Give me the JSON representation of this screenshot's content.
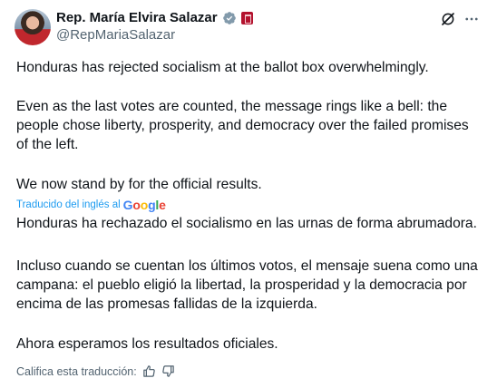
{
  "author": {
    "name": "Rep. María Elvira Salazar",
    "handle": "@RepMariaSalazar"
  },
  "icons": {
    "verified": "verified-badge-icon",
    "government": "government-label-icon",
    "grok": "grok-icon",
    "more": "more-options-icon",
    "thumbs_up": "thumbs-up-icon",
    "thumbs_down": "thumbs-down-icon"
  },
  "colors": {
    "accent": "#1d9bf0",
    "text": "#0f1419",
    "secondary": "#536471",
    "gov_badge": "#b3122e"
  },
  "tweet": {
    "original": [
      "Honduras has rejected socialism at the ballot box overwhelmingly.",
      "Even as the last votes are counted, the message rings like a bell: the people chose liberty, prosperity, and democracy over the failed promises of the left.",
      "We now stand by for the official results."
    ],
    "translated_label": "Traducido del inglés al",
    "translator": "Google",
    "translation": [
      "Honduras ha rechazado el socialismo en las urnas de forma abrumadora.",
      "Incluso cuando se cuentan los últimos votos, el mensaje suena como una campana: el pueblo eligió la libertad, la prosperidad y la democracia por encima de las promesas fallidas de la izquierda.",
      "Ahora esperamos los resultados oficiales."
    ],
    "rate_label": "Califica esta traducción:"
  }
}
